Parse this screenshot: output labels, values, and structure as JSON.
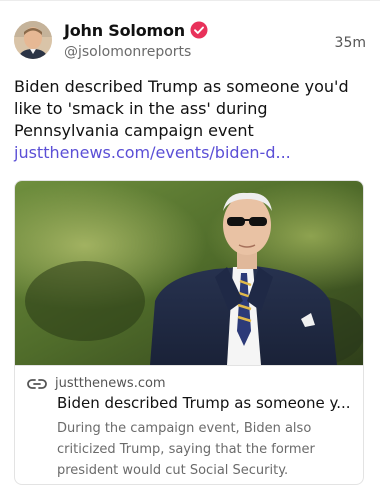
{
  "author": {
    "display_name": "John Solomon",
    "handle": "@jsolomonreports",
    "verified": true,
    "avatar_icon": "person-avatar"
  },
  "post": {
    "timestamp": "35m",
    "text": "Biden described Trump as someone you'd like to 'smack in the ass' during Pennsylvania campaign event ",
    "link_text": "justthenews.com/events/biden-d..."
  },
  "link_card": {
    "domain": "justthenews.com",
    "title": "Biden described Trump as someone y...",
    "description": "During the campaign event, Biden also criticized Trump, saying that the former president would cut Social Security.",
    "link_icon": "chain-link-icon"
  },
  "colors": {
    "verified_badge": "#e8315a",
    "link": "#5b4fd6",
    "muted_text": "#6b6b6b"
  }
}
